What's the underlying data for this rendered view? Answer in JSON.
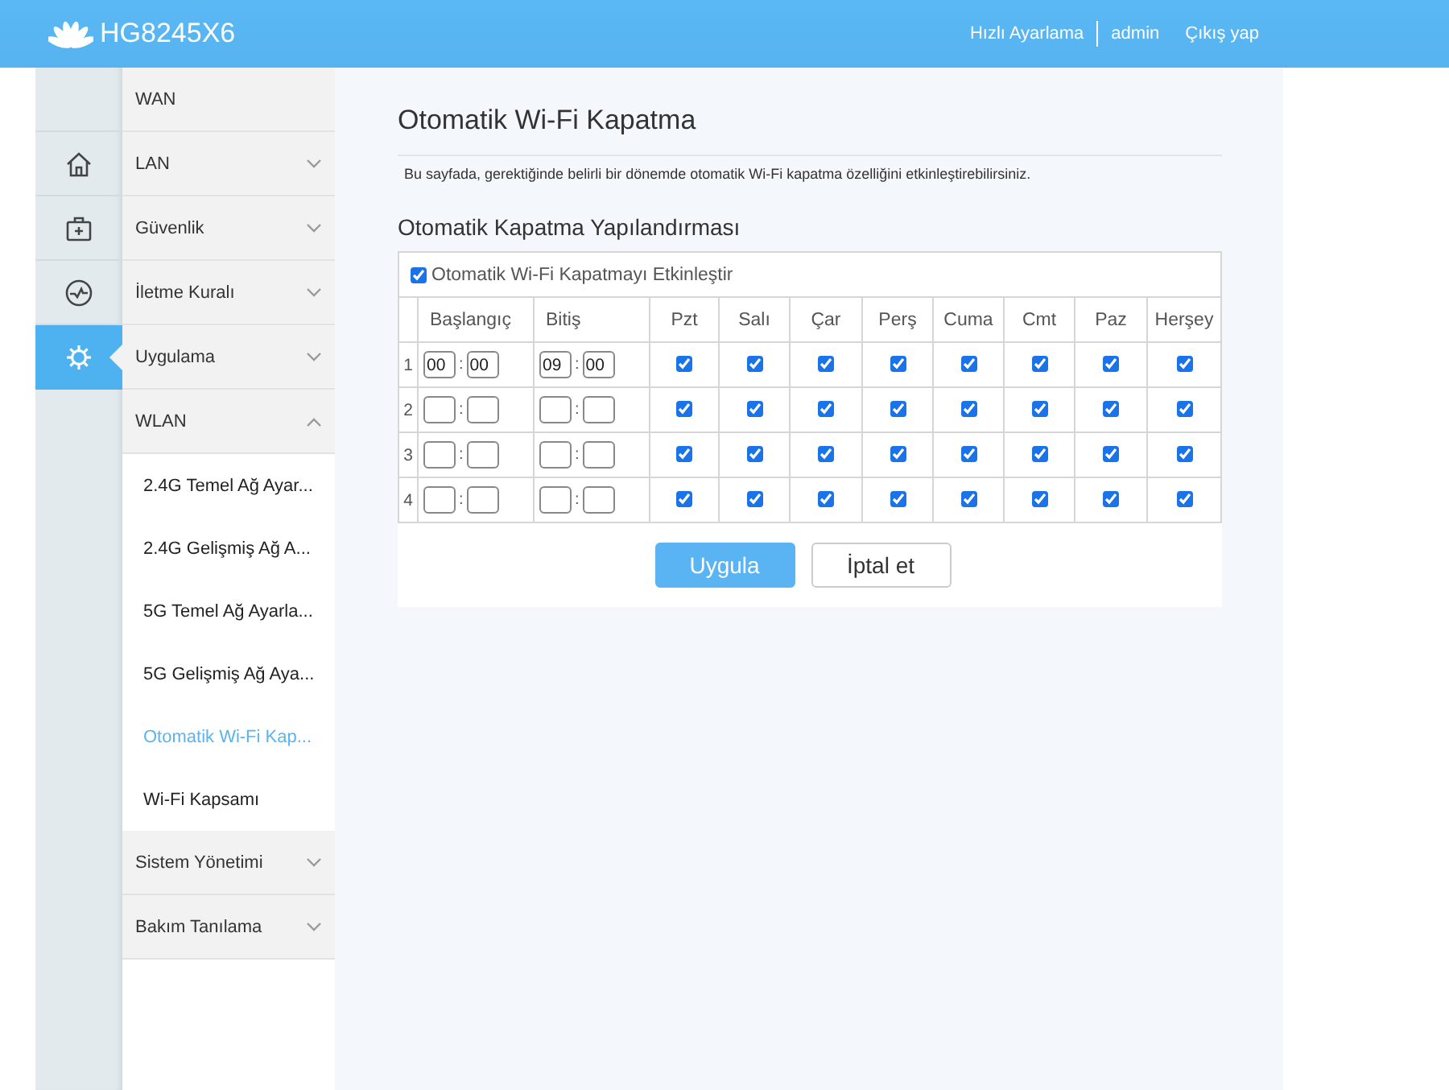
{
  "header": {
    "logo_text": "HG8245X6",
    "links": [
      {
        "label": "Hızlı Ayarlama",
        "divider": true
      },
      {
        "label": "admin",
        "divider": false
      },
      {
        "label": "Çıkış yap",
        "divider": false
      }
    ]
  },
  "rail": [
    {
      "kind": "home",
      "selected": false
    },
    {
      "kind": "kit",
      "selected": false
    },
    {
      "kind": "pulse",
      "selected": false
    },
    {
      "kind": "settings",
      "selected": true
    }
  ],
  "menu": [
    {
      "label": "WAN",
      "kind": "link"
    },
    {
      "label": "LAN",
      "kind": "group",
      "expanded": false
    },
    {
      "label": "Güvenlik",
      "kind": "group",
      "expanded": false
    },
    {
      "label": "İletme Kuralı",
      "kind": "group",
      "expanded": false
    },
    {
      "label": "Uygulama",
      "kind": "group",
      "expanded": false
    },
    {
      "label": "WLAN",
      "kind": "group",
      "expanded": true,
      "children": [
        {
          "label": "2.4G Temel Ağ Ayar...",
          "selected": false
        },
        {
          "label": "2.4G Gelişmiş Ağ A...",
          "selected": false
        },
        {
          "label": "5G Temel Ağ Ayarla...",
          "selected": false
        },
        {
          "label": "5G Gelişmiş Ağ Aya...",
          "selected": false
        },
        {
          "label": "Otomatik Wi-Fi Kap...",
          "selected": true
        },
        {
          "label": "Wi-Fi Kapsamı",
          "selected": false
        }
      ]
    },
    {
      "label": "Sistem Yönetimi",
      "kind": "group",
      "expanded": false
    },
    {
      "label": "Bakım Tanılama",
      "kind": "group",
      "expanded": false
    }
  ],
  "page": {
    "title": "Otomatik Wi-Fi Kapatma",
    "description": "Bu sayfada, gerektiğinde belirli bir dönemde otomatik Wi-Fi kapatma özelliğini etkinleştirebilirsiniz.",
    "section_title": "Otomatik Kapatma Yapılandırması",
    "enable": {
      "label": "Otomatik Wi-Fi Kapatmayı Etkinleştir",
      "checked": true
    },
    "columns": [
      "Başlangıç",
      "Bitiş",
      "Pzt",
      "Salı",
      "Çar",
      "Perş",
      "Cuma",
      "Cmt",
      "Paz",
      "Herşey"
    ],
    "rows": [
      {
        "index": "1",
        "start": {
          "hour": "00",
          "separator": ":",
          "minute": "00"
        },
        "end": {
          "hour": "09",
          "separator": ":",
          "minute": "00"
        },
        "days": [
          true,
          true,
          true,
          true,
          true,
          true,
          true,
          true
        ]
      },
      {
        "index": "2",
        "start": {
          "separator": ":"
        },
        "end": {
          "separator": ":"
        },
        "days": [
          true,
          true,
          true,
          true,
          true,
          true,
          true,
          true
        ]
      },
      {
        "index": "3",
        "start": {
          "separator": ":"
        },
        "end": {
          "separator": ":"
        },
        "days": [
          true,
          true,
          true,
          true,
          true,
          true,
          true,
          true
        ]
      },
      {
        "index": "4",
        "start": {
          "separator": ":"
        },
        "end": {
          "separator": ":"
        },
        "days": [
          true,
          true,
          true,
          true,
          true,
          true,
          true,
          true
        ]
      }
    ],
    "buttons": [
      {
        "label": "Uygula",
        "kind": "primary"
      },
      {
        "label": "İptal et",
        "kind": "secondary"
      }
    ]
  }
}
